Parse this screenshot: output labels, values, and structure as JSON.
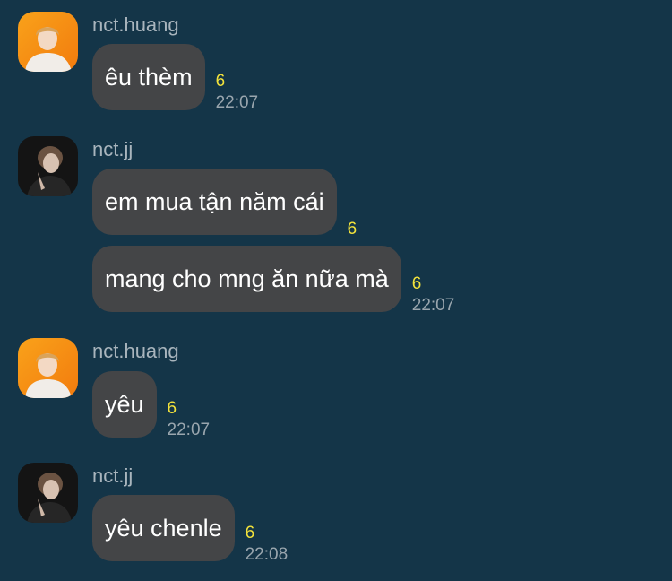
{
  "messages": [
    {
      "sender": "nct.huang",
      "avatar": "avatar-huang",
      "bubbles": [
        {
          "text": "êu thèm",
          "read": "6",
          "time": "22:07"
        }
      ]
    },
    {
      "sender": "nct.jj",
      "avatar": "avatar-jj",
      "bubbles": [
        {
          "text": "em mua tận năm cái",
          "read": "6",
          "time": ""
        },
        {
          "text": "mang cho mng ăn nữa mà",
          "read": "6",
          "time": "22:07"
        }
      ]
    },
    {
      "sender": "nct.huang",
      "avatar": "avatar-huang",
      "bubbles": [
        {
          "text": "yêu",
          "read": "6",
          "time": "22:07"
        }
      ]
    },
    {
      "sender": "nct.jj",
      "avatar": "avatar-jj",
      "bubbles": [
        {
          "text": "yêu chenle",
          "read": "6",
          "time": "22:08"
        }
      ]
    }
  ],
  "colors": {
    "background": "#143548",
    "bubble": "#444547",
    "read_count": "#f2e23b"
  }
}
